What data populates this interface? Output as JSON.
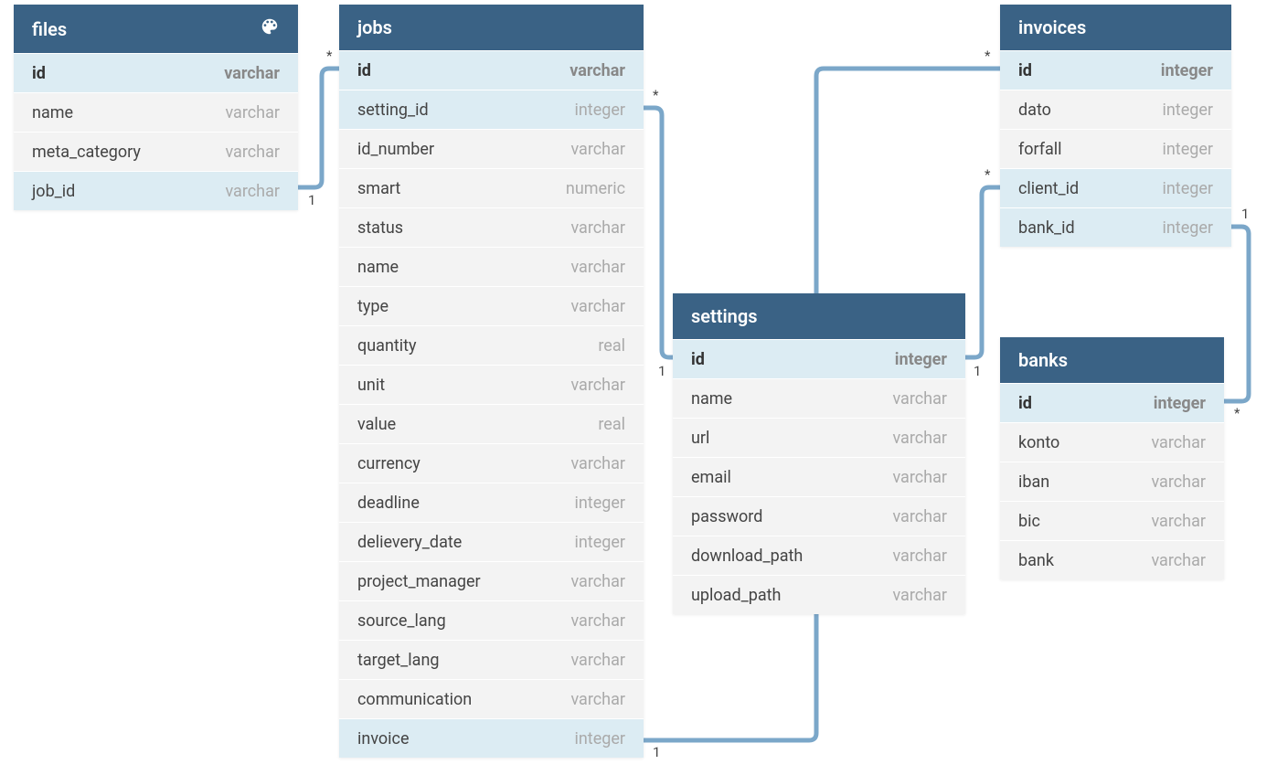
{
  "tables": {
    "files": {
      "title": "files",
      "has_palette": true,
      "rows": [
        {
          "name": "id",
          "type": "varchar",
          "kind": "pk"
        },
        {
          "name": "name",
          "type": "varchar",
          "kind": "normal"
        },
        {
          "name": "meta_category",
          "type": "varchar",
          "kind": "normal"
        },
        {
          "name": "job_id",
          "type": "varchar",
          "kind": "fk"
        }
      ]
    },
    "jobs": {
      "title": "jobs",
      "rows": [
        {
          "name": "id",
          "type": "varchar",
          "kind": "pk"
        },
        {
          "name": "setting_id",
          "type": "integer",
          "kind": "fk"
        },
        {
          "name": "id_number",
          "type": "varchar",
          "kind": "normal"
        },
        {
          "name": "smart",
          "type": "numeric",
          "kind": "normal"
        },
        {
          "name": "status",
          "type": "varchar",
          "kind": "normal"
        },
        {
          "name": "name",
          "type": "varchar",
          "kind": "normal"
        },
        {
          "name": "type",
          "type": "varchar",
          "kind": "normal"
        },
        {
          "name": "quantity",
          "type": "real",
          "kind": "normal"
        },
        {
          "name": "unit",
          "type": "varchar",
          "kind": "normal"
        },
        {
          "name": "value",
          "type": "real",
          "kind": "normal"
        },
        {
          "name": "currency",
          "type": "varchar",
          "kind": "normal"
        },
        {
          "name": "deadline",
          "type": "integer",
          "kind": "normal"
        },
        {
          "name": "delievery_date",
          "type": "integer",
          "kind": "normal"
        },
        {
          "name": "project_manager",
          "type": "varchar",
          "kind": "normal"
        },
        {
          "name": "source_lang",
          "type": "varchar",
          "kind": "normal"
        },
        {
          "name": "target_lang",
          "type": "varchar",
          "kind": "normal"
        },
        {
          "name": "communication",
          "type": "varchar",
          "kind": "normal"
        },
        {
          "name": "invoice",
          "type": "integer",
          "kind": "fk"
        }
      ]
    },
    "settings": {
      "title": "settings",
      "rows": [
        {
          "name": "id",
          "type": "integer",
          "kind": "pk"
        },
        {
          "name": "name",
          "type": "varchar",
          "kind": "normal"
        },
        {
          "name": "url",
          "type": "varchar",
          "kind": "normal"
        },
        {
          "name": "email",
          "type": "varchar",
          "kind": "normal"
        },
        {
          "name": "password",
          "type": "varchar",
          "kind": "normal"
        },
        {
          "name": "download_path",
          "type": "varchar",
          "kind": "normal"
        },
        {
          "name": "upload_path",
          "type": "varchar",
          "kind": "normal"
        }
      ]
    },
    "invoices": {
      "title": "invoices",
      "rows": [
        {
          "name": "id",
          "type": "integer",
          "kind": "pk"
        },
        {
          "name": "dato",
          "type": "integer",
          "kind": "normal"
        },
        {
          "name": "forfall",
          "type": "integer",
          "kind": "normal"
        },
        {
          "name": "client_id",
          "type": "integer",
          "kind": "fk"
        },
        {
          "name": "bank_id",
          "type": "integer",
          "kind": "fk"
        }
      ]
    },
    "banks": {
      "title": "banks",
      "rows": [
        {
          "name": "id",
          "type": "integer",
          "kind": "pk"
        },
        {
          "name": "konto",
          "type": "varchar",
          "kind": "normal"
        },
        {
          "name": "iban",
          "type": "varchar",
          "kind": "normal"
        },
        {
          "name": "bic",
          "type": "varchar",
          "kind": "normal"
        },
        {
          "name": "bank",
          "type": "varchar",
          "kind": "normal"
        }
      ]
    }
  },
  "relationships": [
    {
      "from": "files.job_id",
      "to": "jobs.id",
      "from_card": "*",
      "to_card": "1"
    },
    {
      "from": "jobs.setting_id",
      "to": "settings.id",
      "from_card": "*",
      "to_card": "1"
    },
    {
      "from": "jobs.invoice",
      "to": "invoices.id",
      "from_card": "1",
      "to_card": "*"
    },
    {
      "from": "invoices.client_id",
      "to": "settings.id",
      "from_card": "*",
      "to_card": "1"
    },
    {
      "from": "invoices.bank_id",
      "to": "banks.id",
      "from_card": "1",
      "to_card": "*"
    }
  ],
  "cardinality_labels": {
    "files_jobs_star": "*",
    "files_jobs_one": "1",
    "jobs_settings_star": "*",
    "jobs_settings_one": "1",
    "jobs_invoice_one_left": "1",
    "invoices_star_top": "*",
    "invoices_client_star": "*",
    "settings_one_right": "1",
    "invoices_bank_one": "1",
    "banks_star": "*"
  }
}
